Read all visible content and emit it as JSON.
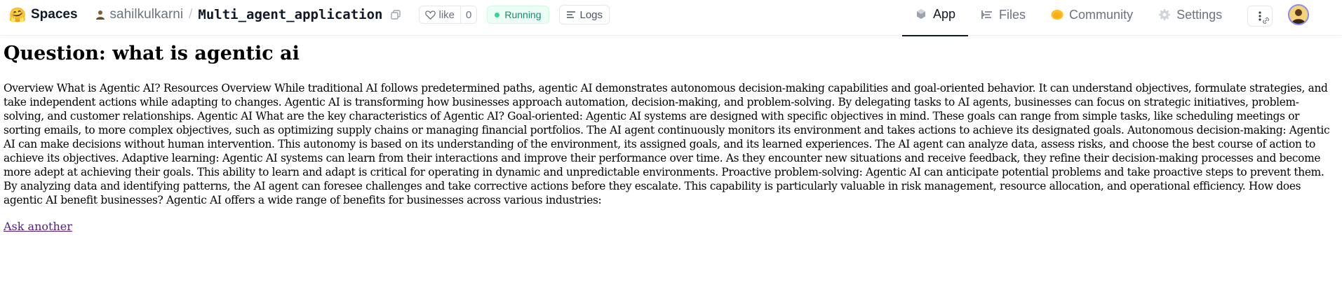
{
  "header": {
    "logo_emoji": "🤗",
    "brand": "Spaces",
    "owner": "sahilkulkarni",
    "separator": "/",
    "repo": "Multi_agent_application",
    "like_label": "like",
    "like_count": "0",
    "status": "Running",
    "logs_label": "Logs",
    "tabs": [
      {
        "label": "App",
        "icon": "cube-icon",
        "active": true
      },
      {
        "label": "Files",
        "icon": "files-icon",
        "active": false
      },
      {
        "label": "Community",
        "icon": "community-icon",
        "active": false
      },
      {
        "label": "Settings",
        "icon": "gear-icon",
        "active": false
      }
    ]
  },
  "main": {
    "question": "Question: what is agentic ai",
    "answer": "Overview What is Agentic AI? Resources Overview While traditional AI follows predetermined paths, agentic AI demonstrates autonomous decision-making capabilities and goal-oriented behavior. It can understand objectives, formulate strategies, and take independent actions while adapting to changes. Agentic AI is transforming how businesses approach automation, decision-making, and problem-solving. By delegating tasks to AI agents, businesses can focus on strategic initiatives, problem-solving, and customer relationships. Agentic AI What are the key characteristics of Agentic AI? Goal-oriented: Agentic AI systems are designed with specific objectives in mind. These goals can range from simple tasks, like scheduling meetings or sorting emails, to more complex objectives, such as optimizing supply chains or managing financial portfolios. The AI agent continuously monitors its environment and takes actions to achieve its designated goals. Autonomous decision-making: Agentic AI can make decisions without human intervention. This autonomy is based on its understanding of the environment, its assigned goals, and its learned experiences. The AI agent can analyze data, assess risks, and choose the best course of action to achieve its objectives. Adaptive learning: Agentic AI systems can learn from their interactions and improve their performance over time. As they encounter new situations and receive feedback, they refine their decision-making processes and become more adept at achieving their goals. This ability to learn and adapt is critical for operating in dynamic and unpredictable environments. Proactive problem-solving: Agentic AI can anticipate potential problems and take proactive steps to prevent them. By analyzing data and identifying patterns, the AI agent can foresee challenges and take corrective actions before they escalate. This capability is particularly valuable in risk management, resource allocation, and operational efficiency. How does agentic AI benefit businesses? Agentic AI offers a wide range of benefits for businesses across various industries:",
    "link": "Ask another"
  },
  "colors": {
    "status_green": "#059669",
    "avatar_ring": "#818cf8",
    "link_visited": "#551a8b"
  }
}
